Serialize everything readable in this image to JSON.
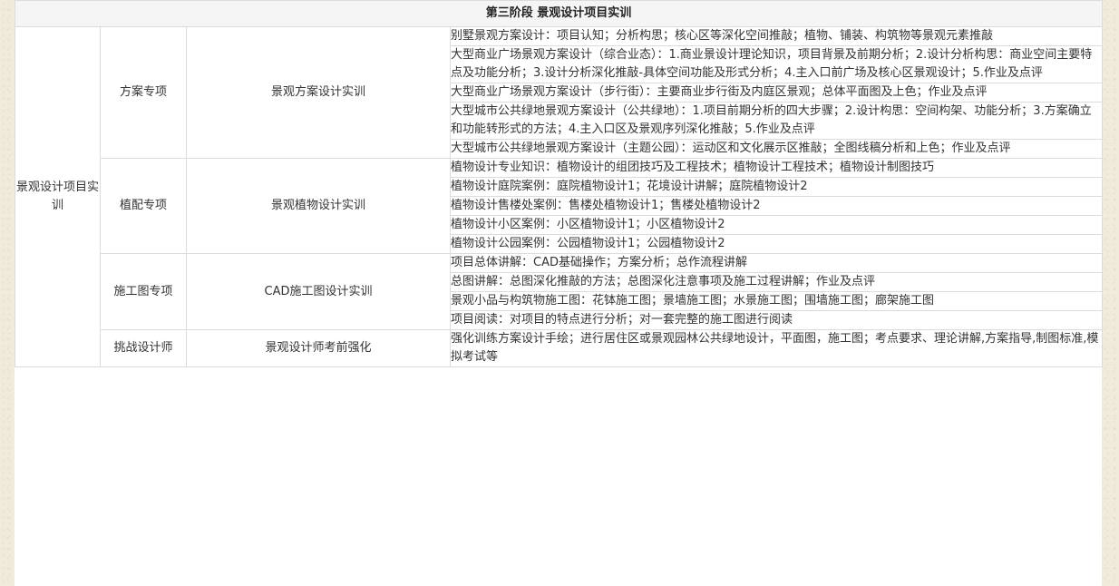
{
  "header": {
    "title": "第三阶段 景观设计项目实训"
  },
  "column1": {
    "label": "景观设计项目实训"
  },
  "sections": [
    {
      "name": "方案专项",
      "course": "景观方案设计实训",
      "items": [
        "别墅景观方案设计：项目认知；分析构思；核心区等深化空间推敲；植物、铺装、构筑物等景观元素推敲",
        "大型商业广场景观方案设计（综合业态）：1.商业景设计理论知识，项目背景及前期分析；2.设计分析构思：商业空间主要特点及功能分析；3.设计分析深化推敲-具体空间功能及形式分析；4.主入口前广场及核心区景观设计；5.作业及点评",
        "大型商业广场景观方案设计（步行街）：主要商业步行街及内庭区景观；总体平面图及上色；作业及点评",
        "大型城市公共绿地景观方案设计（公共绿地）：1.项目前期分析的四大步骤；2.设计构思：空间构架、功能分析；3.方案确立和功能转形式的方法；4.主入口区及景观序列深化推敲；5.作业及点评",
        "大型城市公共绿地景观方案设计（主题公园）：运动区和文化展示区推敲；全图线稿分析和上色；作业及点评"
      ]
    },
    {
      "name": "植配专项",
      "course": "景观植物设计实训",
      "items": [
        "植物设计专业知识：植物设计的组团技巧及工程技术；植物设计工程技术；植物设计制图技巧",
        "植物设计庭院案例：庭院植物设计1；花境设计讲解；庭院植物设计2",
        "植物设计售楼处案例：售楼处植物设计1；售楼处植物设计2",
        "植物设计小区案例：小区植物设计1；小区植物设计2",
        "植物设计公园案例：公园植物设计1；公园植物设计2"
      ]
    },
    {
      "name": "施工图专项",
      "course": "CAD施工图设计实训",
      "items": [
        "项目总体讲解：CAD基础操作；方案分析；总作流程讲解",
        "总图讲解：总图深化推敲的方法；总图深化注意事项及施工过程讲解；作业及点评",
        "景观小品与构筑物施工图：花钵施工图；景墙施工图；水景施工图；围墙施工图；廊架施工图",
        "项目阅读：对项目的特点进行分析；对一套完整的施工图进行阅读"
      ]
    },
    {
      "name": "挑战设计师",
      "course": "景观设计师考前强化",
      "items": [
        "强化训练方案设计手绘；进行居住区或景观园林公共绿地设计，平面图，施工图；考点要求、理论讲解,方案指导,制图标准,模拟考试等"
      ]
    }
  ]
}
